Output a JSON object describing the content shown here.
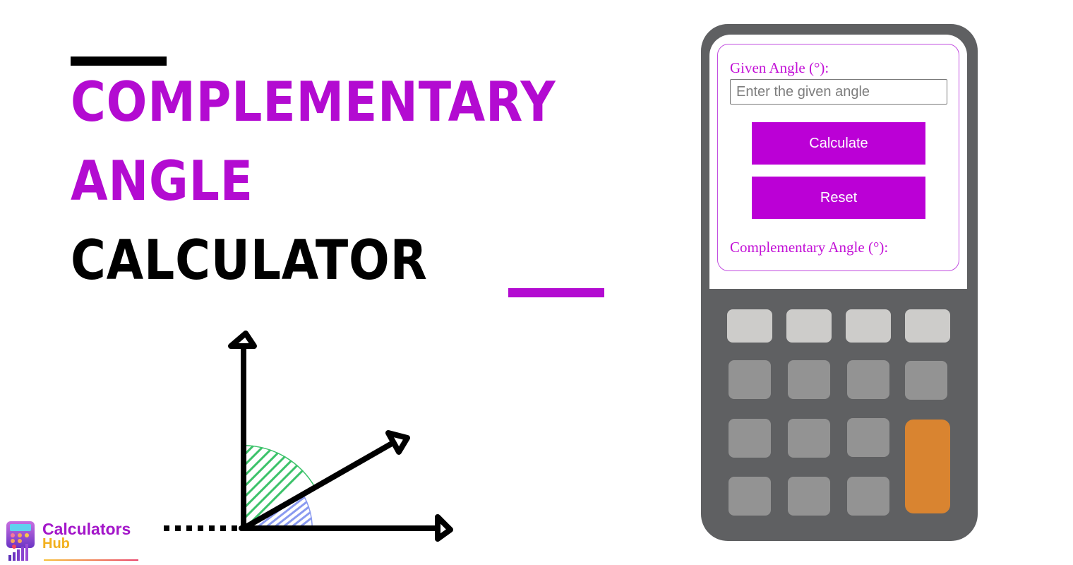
{
  "title": {
    "line1": "COMPLEMENTARY",
    "line2": "ANGLE",
    "line3": "CALCULATOR",
    "accent_color": "#b30bd1",
    "text_color": "#000000"
  },
  "diagram": {
    "description": "right-angle axes with a ray splitting it into two complementary angles",
    "angle_colors": {
      "upper": "#3cc26a",
      "lower": "#8a9af0"
    }
  },
  "calculator": {
    "input_label": "Given Angle (°):",
    "input_value": "",
    "input_placeholder": "Enter the given angle",
    "calculate_label": "Calculate",
    "reset_label": "Reset",
    "result_label": "Complementary Angle (°):",
    "result_value": "",
    "button_color": "#bb00d6",
    "keypad": {
      "rows": [
        [
          "light",
          "light",
          "light",
          "light"
        ],
        [
          "dark",
          "dark",
          "dark",
          "dark"
        ],
        [
          "dark",
          "dark",
          "dark",
          "orange"
        ],
        [
          "dark",
          "dark",
          "dark"
        ]
      ]
    }
  },
  "logo": {
    "line1": "Calculators",
    "line2": "Hub"
  }
}
